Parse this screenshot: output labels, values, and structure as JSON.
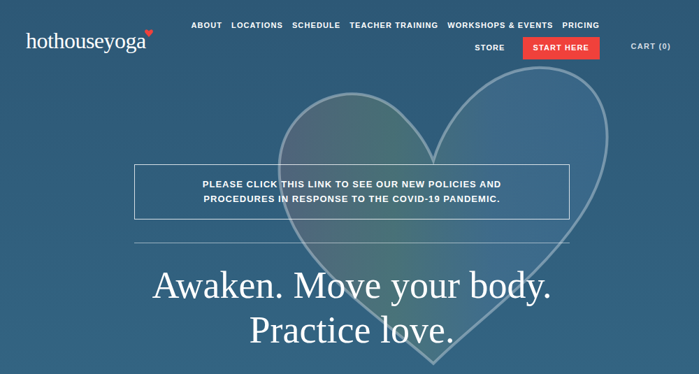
{
  "logo": {
    "text": "hothouseyoga"
  },
  "nav": {
    "rows": [
      [
        "ABOUT",
        "LOCATIONS",
        "SCHEDULE",
        "TEACHER TRAINING",
        "WORKSHOPS & EVENTS",
        "PRICING"
      ],
      [
        "STORE"
      ]
    ],
    "cta": "START HERE"
  },
  "cart": "CART (0)",
  "notice": [
    "PLEASE CLICK THIS LINK TO SEE OUR NEW POLICIES AND",
    "PROCEDURES IN RESPONSE TO THE COVID-19 PANDEMIC."
  ],
  "headline": [
    "Awaken. Move your body.",
    "Practice love."
  ]
}
